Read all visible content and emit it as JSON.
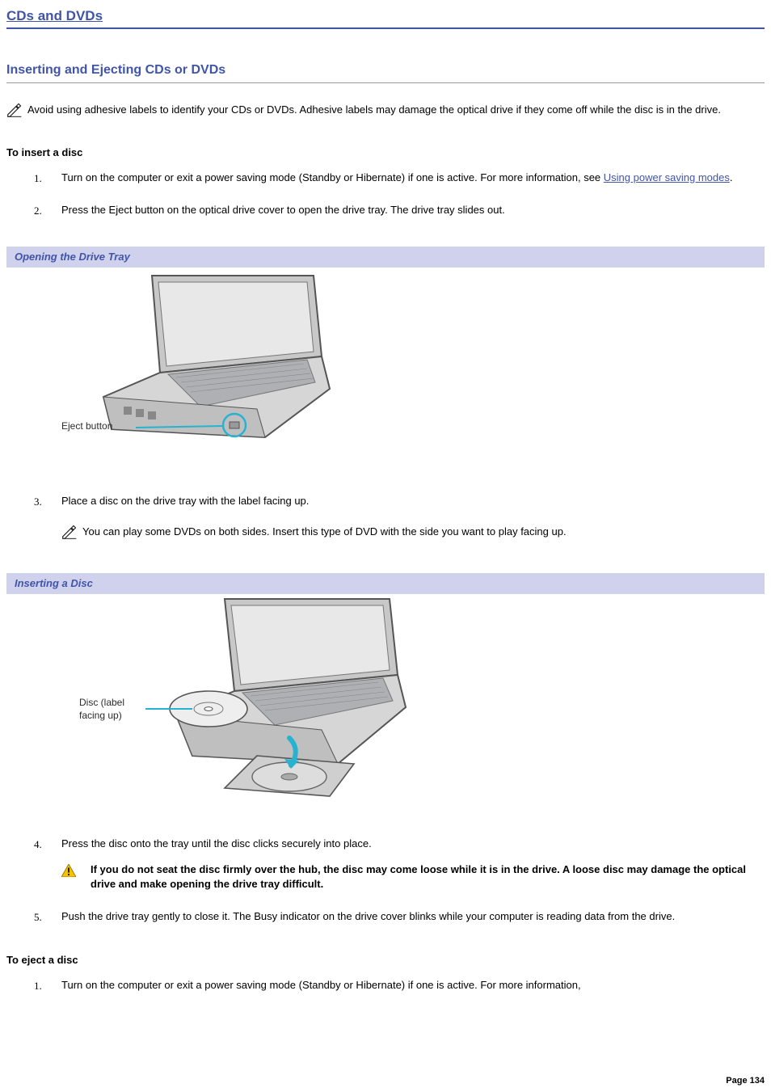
{
  "page_title": "CDs and DVDs",
  "section_title": "Inserting and Ejecting CDs or DVDs",
  "note_top": "Avoid using adhesive labels to identify your CDs or DVDs. Adhesive labels may damage the optical drive if they come off while the disc is in the drive.",
  "insert_heading": "To insert a disc",
  "insert_steps": {
    "s1_a": "Turn on the computer or exit a power saving mode (Standby or Hibernate) if one is active. For more information, see ",
    "s1_link": "Using power saving modes",
    "s1_b": ".",
    "s2": "Press the Eject button on the optical drive cover to open the drive tray. The drive tray slides out.",
    "s3": "Place a disc on the drive tray with the label facing up.",
    "s3_note": "You can play some DVDs on both sides. Insert this type of DVD with the side you want to play facing up.",
    "s4": "Press the disc onto the tray until the disc clicks securely into place.",
    "s4_warn": "If you do not seat the disc firmly over the hub, the disc may come loose while it is in the drive. A loose disc may damage the optical drive and make opening the drive tray difficult.",
    "s5": "Push the drive tray gently to close it. The Busy indicator on the drive cover blinks while your computer is reading data from the drive."
  },
  "fig1_title": "Opening the Drive Tray",
  "fig1_label": "Eject button",
  "fig2_title": "Inserting a Disc",
  "fig2_label1": "Disc (label",
  "fig2_label2": "facing up)",
  "eject_heading": "To eject a disc",
  "eject_steps": {
    "s1": "Turn on the computer or exit a power saving mode (Standby or Hibernate) if one is active. For more information,"
  },
  "page_number": "Page 134"
}
